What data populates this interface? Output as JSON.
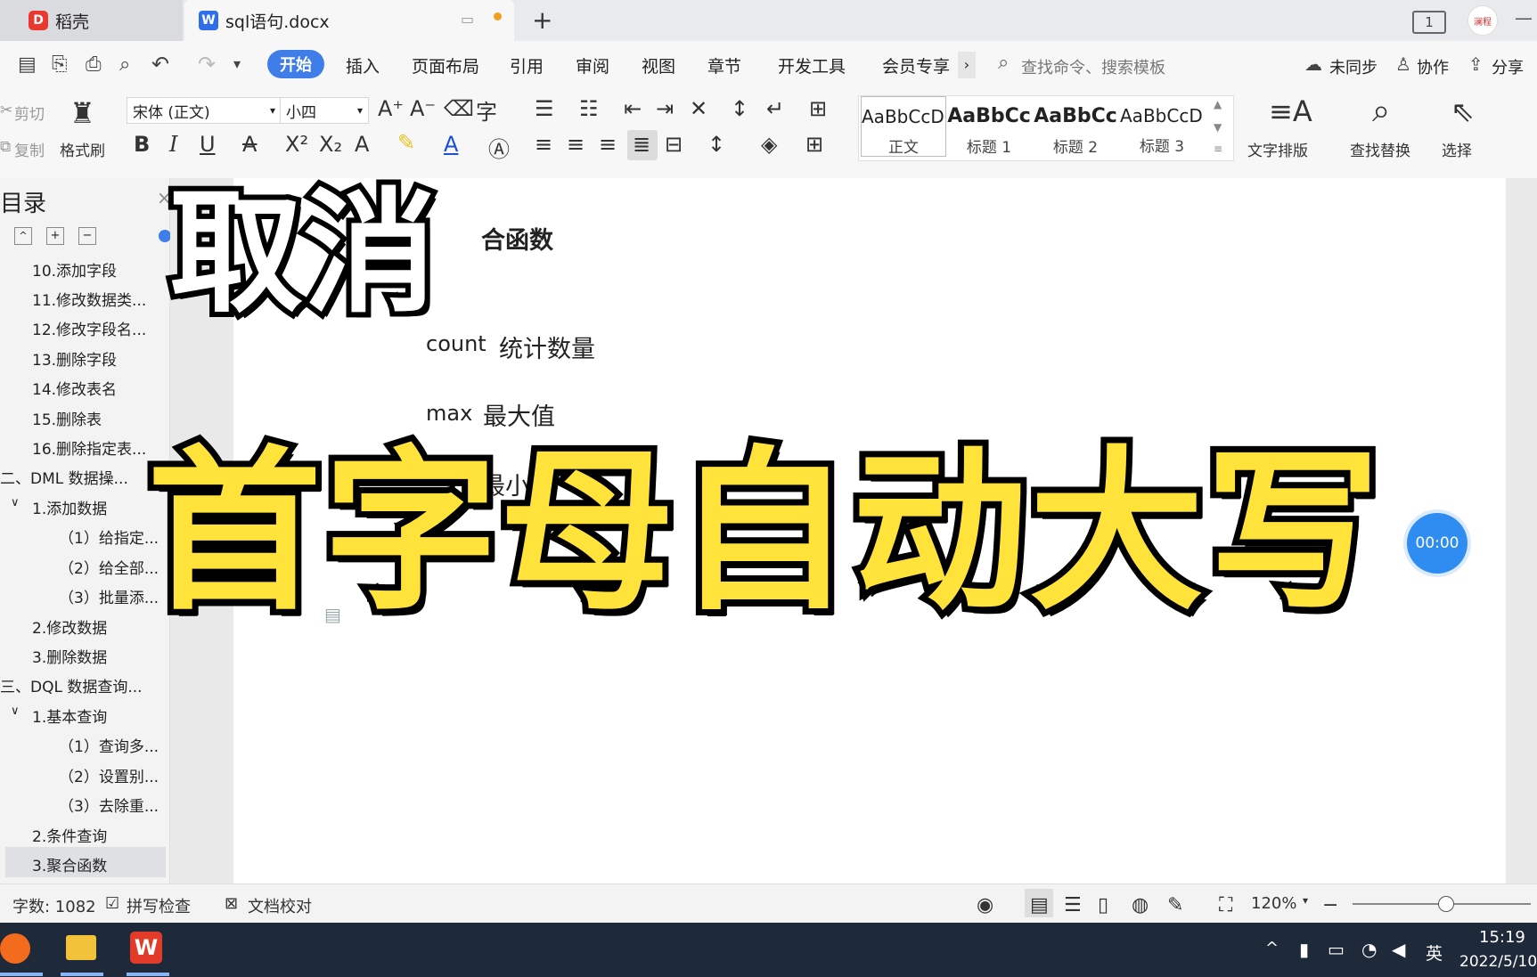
{
  "titlebar": {
    "home_tab": "稻壳",
    "doc_tab": "sql语句.docx",
    "add_tab": "+",
    "layout_badge": "1",
    "avatar_text": "澜程"
  },
  "menu": {
    "items": [
      "开始",
      "插入",
      "页面布局",
      "引用",
      "审阅",
      "视图",
      "章节",
      "开发工具",
      "会员专享"
    ],
    "search_placeholder": "查找命令、搜索模板",
    "sync": "未同步",
    "collab": "协作",
    "share": "分享"
  },
  "ribbon": {
    "cut": "剪切",
    "copy": "复制",
    "format_painter": "格式刷",
    "font_name": "宋体 (正文)",
    "font_size": "小四",
    "styles": [
      {
        "sample": "AaBbCcDd",
        "label": "正文"
      },
      {
        "sample": "AaBbCc",
        "label": "标题 1"
      },
      {
        "sample": "AaBbCc",
        "label": "标题 2"
      },
      {
        "sample": "AaBbCcDd",
        "label": "标题 3"
      }
    ],
    "text_layout": "文字排版",
    "find_replace": "查找替换",
    "select": "选择"
  },
  "sidebar": {
    "title": "目录",
    "items": [
      "10.添加字段",
      "11.修改数据类...",
      "12.修改字段名...",
      "13.删除字段",
      "14.修改表名",
      "15.删除表",
      "16.删除指定表...",
      "二、DML 数据操...",
      "1.添加数据",
      "（1）给指定...",
      "（2）给全部...",
      "（3）批量添...",
      "2.修改数据",
      "3.删除数据",
      "三、DQL 数据查询...",
      "1.基本查询",
      "（1）查询多...",
      "（2）设置别...",
      "（3）去除重...",
      "2.条件查询",
      "3.聚合函数"
    ]
  },
  "document": {
    "heading": "合函数",
    "line1_en": "count",
    "line1_cn": "统计数量",
    "line2_en": "max",
    "line2_cn": "最大值",
    "line3_cn": "最小"
  },
  "overlay": {
    "top": "取消",
    "main": "首字母自动大写",
    "timer": "00:00"
  },
  "status": {
    "word_count": "字数: 1082",
    "spell_check": "拼写检查",
    "doc_proof": "文档校对",
    "zoom": "120%"
  },
  "taskbar": {
    "ime": "英",
    "time": "15:19",
    "date": "2022/5/10"
  },
  "colors": {
    "accent": "#3f7ee8",
    "overlay_yellow": "#ffe23a",
    "timer_blue": "#2f8cf0"
  }
}
